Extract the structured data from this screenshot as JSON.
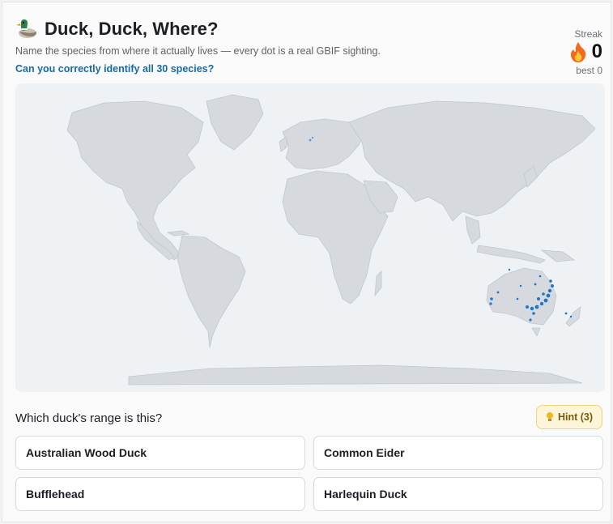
{
  "header": {
    "title": "Duck, Duck, Where?",
    "subtitle": "Name the species from where it actually lives — every dot is a real GBIF sighting.",
    "challenge_link": "Can you correctly identify all 30 species?"
  },
  "streak": {
    "label": "Streak",
    "value": "0",
    "best": "best 0"
  },
  "map": {
    "land_color": "#d6dadf",
    "ocean_color": "#eef2f5",
    "sighting_color": "#1f77c4"
  },
  "question": {
    "prompt": "Which duck's range is this?",
    "hint_label": "Hint (3)"
  },
  "answers": [
    {
      "label": "Australian Wood Duck"
    },
    {
      "label": "Common Eider"
    },
    {
      "label": "Bufflehead"
    },
    {
      "label": "Harlequin Duck"
    }
  ]
}
